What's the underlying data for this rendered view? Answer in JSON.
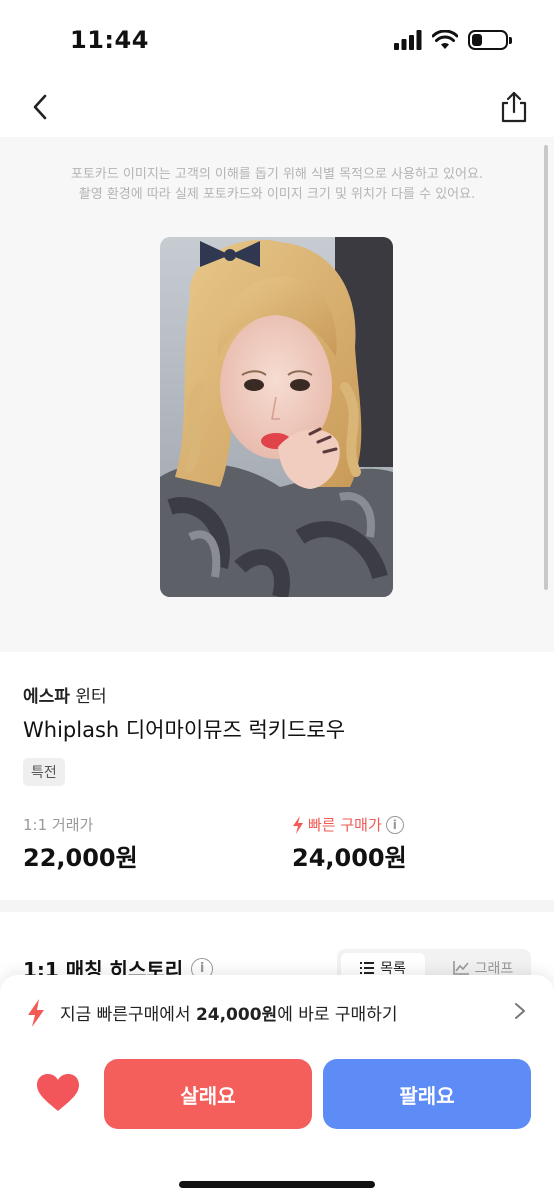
{
  "status_bar": {
    "time": "11:44",
    "battery_level": 0.3
  },
  "notice": {
    "line1": "포토카드 이미지는 고객의 이해를 돕기 위해 식별 목적으로 사용하고 있어요.",
    "line2": "촬영 환경에 따라 실제 포토카드와 이미지 크기 및 위치가 다를 수 있어요."
  },
  "product": {
    "group": "에스파",
    "member": "윈터",
    "title": "Whiplash 디어마이뮤즈 럭키드로우",
    "tag": "특전",
    "trade_price_label": "1:1 거래가",
    "trade_price": "22,000원",
    "fast_price_label": "빠른 구매가",
    "fast_price": "24,000원"
  },
  "history": {
    "title": "1:1 매칭 히스토리",
    "tabs": [
      {
        "label": "목록",
        "active": true
      },
      {
        "label": "그래프",
        "active": false
      }
    ]
  },
  "bottom_bar": {
    "banner_prefix": "지금 빠른구매에서 ",
    "banner_price": "24,000원",
    "banner_suffix": "에 바로 구매하기",
    "buy_label": "살래요",
    "sell_label": "팔래요"
  },
  "colors": {
    "accent_red": "#f45e5b",
    "accent_blue": "#5e8cf7",
    "fast_red": "#f25a55"
  }
}
